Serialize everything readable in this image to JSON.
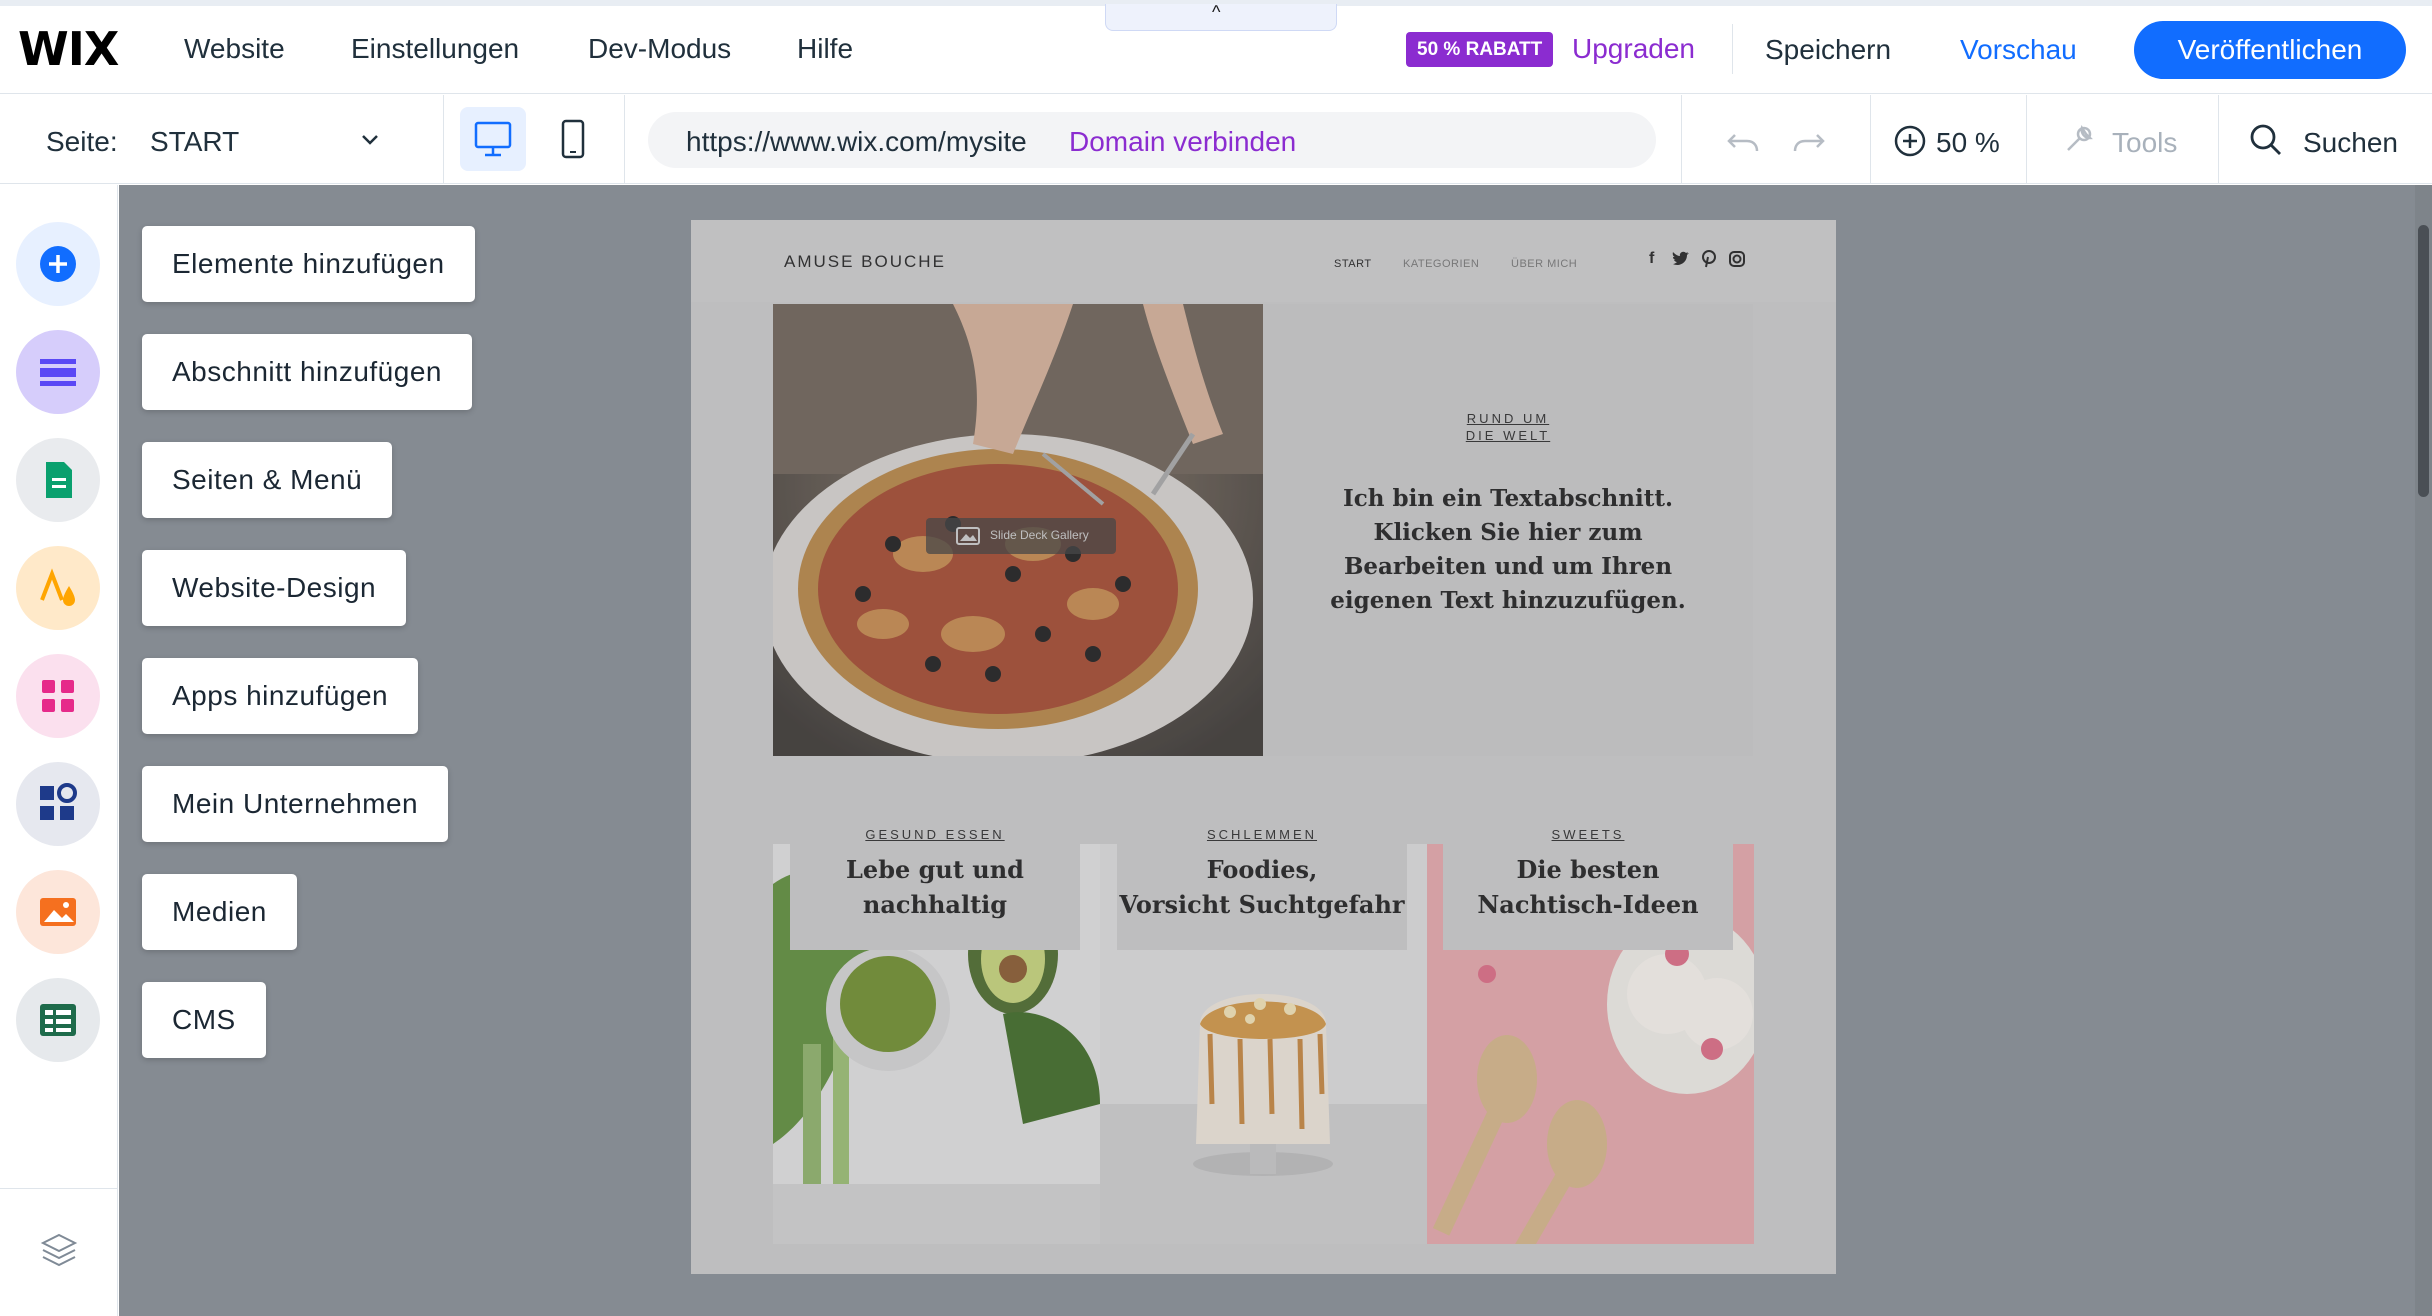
{
  "topbar": {
    "logo": "WIX",
    "menu": [
      "Website",
      "Einstellungen",
      "Dev-Modus",
      "Hilfe"
    ],
    "badge": "50 % RABATT",
    "upgrade": "Upgraden",
    "save": "Speichern",
    "preview": "Vorschau",
    "publish": "Veröffentlichen",
    "collapse_icon": "^"
  },
  "subbar": {
    "page_label": "Seite:",
    "page_value": "START",
    "url": "https://www.wix.com/mysite",
    "domain_link": "Domain verbinden",
    "zoom": "50 %",
    "tools": "Tools",
    "search": "Suchen"
  },
  "sidebar": {
    "items": [
      {
        "label": "Elemente hinzufügen",
        "icon": "plus-icon",
        "color": "#116dff"
      },
      {
        "label": "Abschnitt hinzufügen",
        "icon": "section-icon",
        "color": "#5a48f5"
      },
      {
        "label": "Seiten & Menü",
        "icon": "page-icon",
        "color": "#0aa06e"
      },
      {
        "label": "Website-Design",
        "icon": "design-icon",
        "color": "#ffa500"
      },
      {
        "label": "Apps hinzufügen",
        "icon": "apps-icon",
        "color": "#e62a8a"
      },
      {
        "label": "Mein Unternehmen",
        "icon": "business-icon",
        "color": "#1e3a8a"
      },
      {
        "label": "Medien",
        "icon": "media-icon",
        "color": "#f5701f"
      },
      {
        "label": "CMS",
        "icon": "cms-icon",
        "color": "#1e6b4b"
      }
    ]
  },
  "site": {
    "brand": "AMUSE BOUCHE",
    "nav": [
      "START",
      "KATEGORIEN",
      "ÜBER MICH"
    ],
    "social": [
      "f",
      "t",
      "p",
      "i"
    ],
    "hero_eyebrow_1": "RUND UM",
    "hero_eyebrow_2": "DIE WELT",
    "hero_text": "Ich bin ein Textabschnitt. Klicken Sie hier zum Bearbeiten und um Ihren eigenen Text hinzuzufügen.",
    "gallery_tag": "Slide Deck Gallery",
    "cards": [
      {
        "eyebrow": "GESUND ESSEN",
        "title_1": "Lebe gut und",
        "title_2": "nachhaltig"
      },
      {
        "eyebrow": "SCHLEMMEN",
        "title_1": "Foodies,",
        "title_2": "Vorsicht Suchtgefahr"
      },
      {
        "eyebrow": "SWEETS",
        "title_1": "Die besten",
        "title_2": "Nachtisch-Ideen"
      }
    ]
  }
}
